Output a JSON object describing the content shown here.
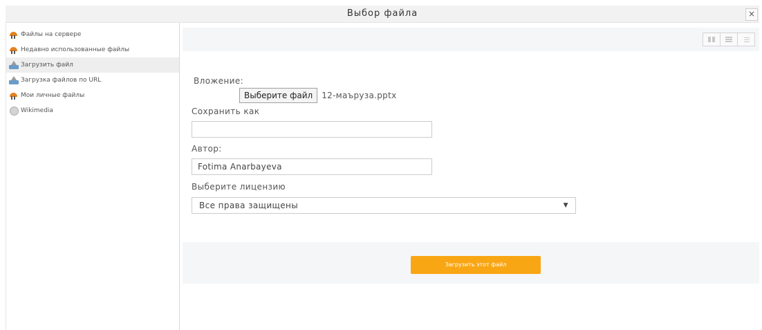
{
  "dialog": {
    "title": "Выбор файла",
    "close_label": "×"
  },
  "sidebar": {
    "items": [
      {
        "label": "Файлы на сервере",
        "icon": "moodle-icon",
        "active": false
      },
      {
        "label": "Недавно использованные файлы",
        "icon": "moodle-icon",
        "active": false
      },
      {
        "label": "Загрузить файл",
        "icon": "upload-icon",
        "active": true
      },
      {
        "label": "Загрузка файлов по URL",
        "icon": "upload-icon",
        "active": false
      },
      {
        "label": "Мои личные файлы",
        "icon": "moodle-icon",
        "active": false
      },
      {
        "label": "Wikimedia",
        "icon": "wikimedia-icon",
        "active": false
      }
    ]
  },
  "form": {
    "attachment_label": "Вложение:",
    "choose_button": "Выберите файл",
    "chosen_file": "12-маъруза.pptx",
    "save_as_label": "Сохранить как",
    "save_as_value": "",
    "author_label": "Автор:",
    "author_value": "Fotima Anarbayeva",
    "license_label": "Выберите лицензию",
    "license_value": "Все права защищены",
    "license_caret": "▼"
  },
  "footer": {
    "upload_button": "Загрузить этот файл"
  },
  "colors": {
    "accent": "#f9a615",
    "active_item_bg": "#eeeeee"
  }
}
